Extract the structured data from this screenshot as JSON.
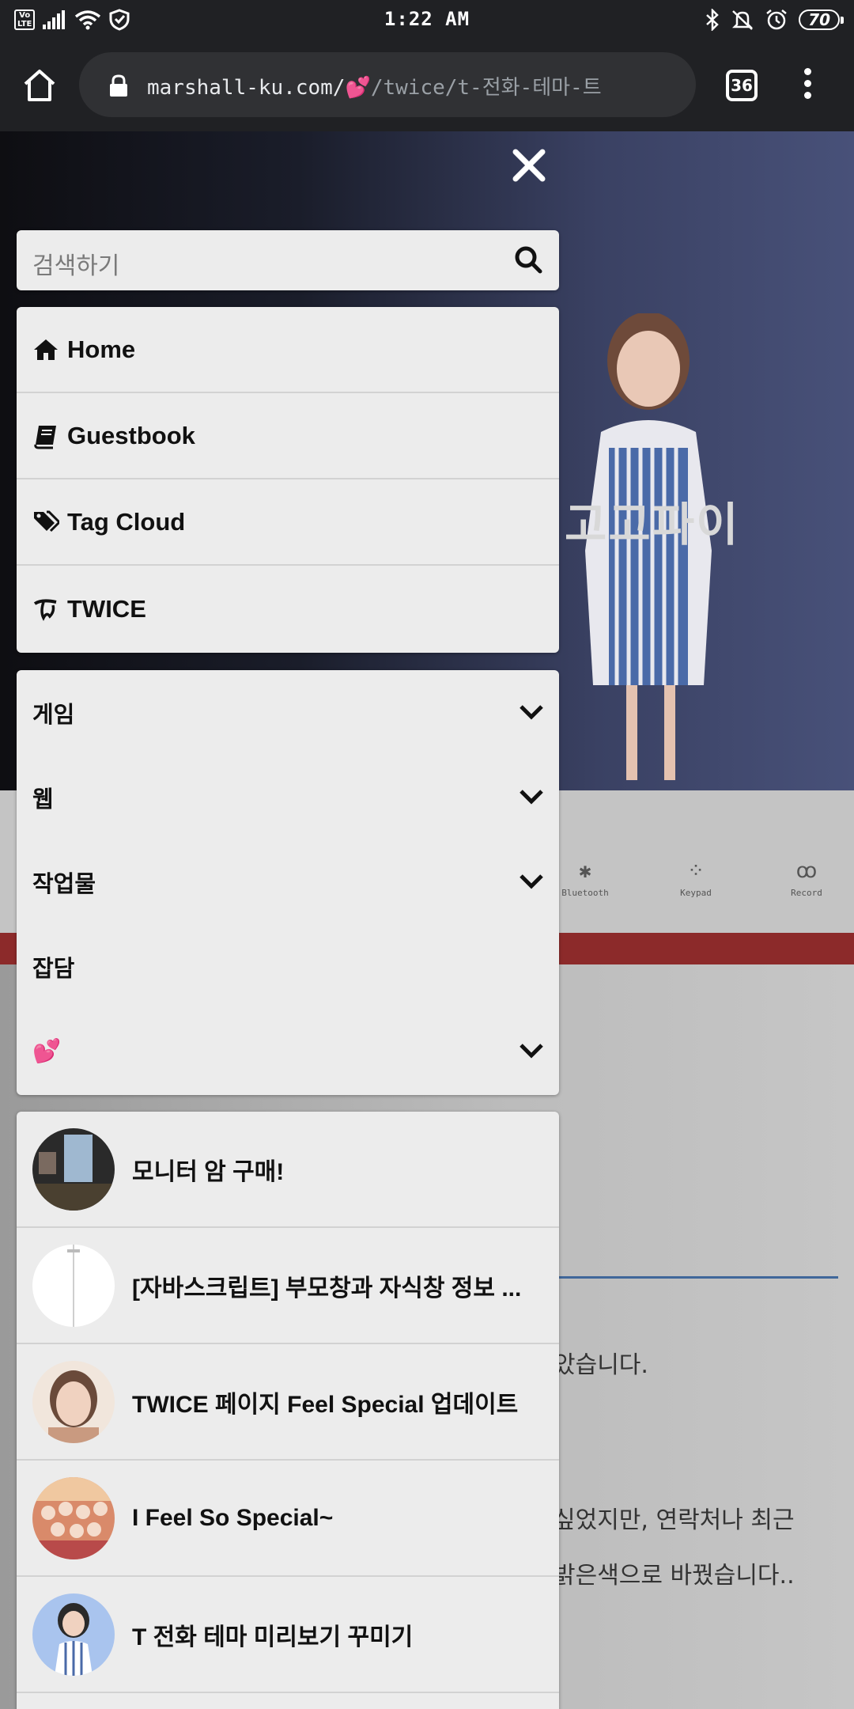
{
  "status_bar": {
    "time": "1:22 AM",
    "volte": "Vo LTE",
    "battery": "70",
    "icons": [
      "volte-icon",
      "signal-icon",
      "wifi-icon",
      "shield-icon",
      "bluetooth-icon",
      "mute-icon",
      "alarm-icon",
      "battery-icon"
    ]
  },
  "browser": {
    "url_host": "marshall-ku.com/",
    "url_path": "/twice/t-전화-테마-트",
    "url_emoji": "💕",
    "tab_count": "36"
  },
  "background_page": {
    "hero_text": "고고파이",
    "call_buttons": [
      "Bluetooth",
      "Keypad",
      "Record"
    ],
    "body_lines": [
      "았습니다.",
      " 싶었지만, 연락처나 최근",
      " 밝은색으로 바꿨습니다.."
    ]
  },
  "search": {
    "placeholder": "검색하기"
  },
  "nav": {
    "items": [
      {
        "label": "Home",
        "icon": "home-icon"
      },
      {
        "label": "Guestbook",
        "icon": "book-icon"
      },
      {
        "label": "Tag Cloud",
        "icon": "tags-icon"
      },
      {
        "label": "TWICE",
        "icon": "twice-logo-icon"
      }
    ]
  },
  "categories": {
    "items": [
      {
        "label": "게임",
        "expandable": true
      },
      {
        "label": "웹",
        "expandable": true
      },
      {
        "label": "작업물",
        "expandable": true
      },
      {
        "label": "잡담",
        "expandable": false
      },
      {
        "label": "💕",
        "expandable": true
      }
    ]
  },
  "posts": {
    "items": [
      {
        "title": "모니터 암 구매!"
      },
      {
        "title": "[자바스크립트] 부모창과 자식창 정보 ..."
      },
      {
        "title": "TWICE 페이지 Feel Special 업데이트"
      },
      {
        "title": "I Feel So Special~"
      },
      {
        "title": "T 전화 테마 미리보기 꾸미기"
      }
    ]
  },
  "colors": {
    "chrome_dark": "#202124",
    "panel_bg": "#ececec",
    "divider": "#d2d2d2",
    "heart": "#d81b3c"
  }
}
